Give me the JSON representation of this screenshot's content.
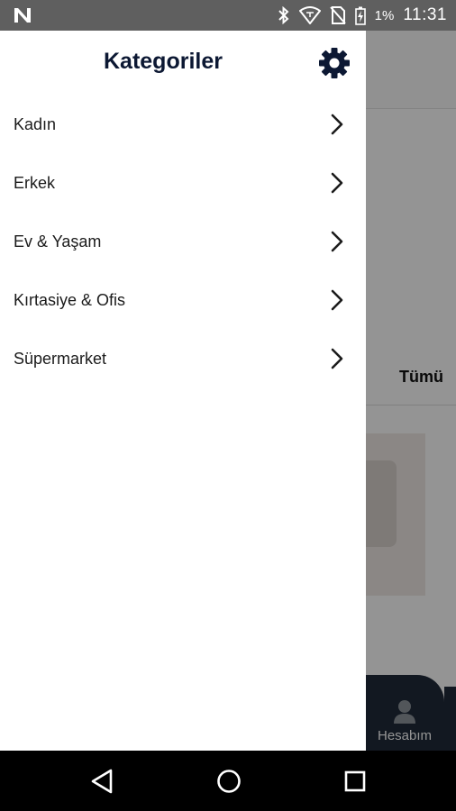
{
  "status_bar": {
    "battery_percent": "1%",
    "time": "11:31",
    "icons": [
      "n-logo-icon",
      "bluetooth-icon",
      "wifi-icon",
      "no-sim-icon",
      "battery-charging-icon"
    ]
  },
  "drawer": {
    "title": "Kategoriler",
    "settings_icon": "gear-icon",
    "categories": [
      {
        "label": "Kadın"
      },
      {
        "label": "Erkek"
      },
      {
        "label": "Ev & Yaşam"
      },
      {
        "label": "Kırtasiye & Ofis"
      },
      {
        "label": "Süpermarket"
      }
    ]
  },
  "background": {
    "tab_all": "Tümü",
    "bottom_tab_label": "Hesabım"
  },
  "nav_bar": {
    "icons": [
      "back-icon",
      "home-icon",
      "recents-icon"
    ]
  },
  "colors": {
    "title": "#0c1833",
    "status_bar": "#5f5f5f",
    "bottom_tab": "#1f2a3a"
  }
}
